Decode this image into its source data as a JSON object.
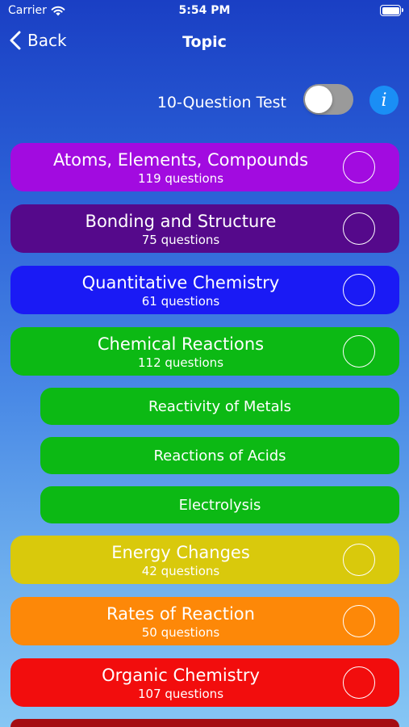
{
  "status": {
    "carrier": "Carrier",
    "time": "5:54 PM"
  },
  "nav": {
    "back_label": "Back",
    "title": "Topic"
  },
  "test": {
    "label": "10-Question Test",
    "toggle_on": false,
    "info_glyph": "i"
  },
  "topics": [
    {
      "name": "Atoms, Elements, Compounds",
      "count": "119 questions",
      "color": "#a20be0"
    },
    {
      "name": "Bonding and Structure",
      "count": "75 questions",
      "color": "#55098b"
    },
    {
      "name": "Quantitative Chemistry",
      "count": "61 questions",
      "color": "#1a1af5"
    },
    {
      "name": "Chemical Reactions",
      "count": "112 questions",
      "color": "#0cb914"
    },
    {
      "name": "Energy Changes",
      "count": "42 questions",
      "color": "#d9c90c"
    },
    {
      "name": "Rates of Reaction",
      "count": "50 questions",
      "color": "#fd8808"
    },
    {
      "name": "Organic Chemistry",
      "count": "107 questions",
      "color": "#f20d0d"
    }
  ],
  "subtopics": [
    {
      "name": "Reactivity of Metals",
      "color": "#0cb914"
    },
    {
      "name": "Reactions of Acids",
      "color": "#0cb914"
    },
    {
      "name": "Electrolysis",
      "color": "#0cb914"
    }
  ],
  "partial_bar_color": "#a50d12"
}
